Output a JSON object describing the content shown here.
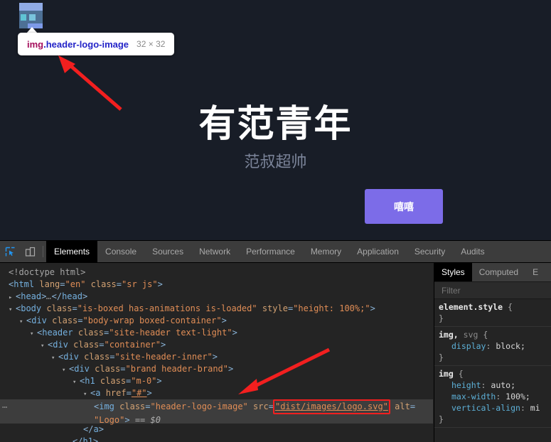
{
  "page": {
    "title": "有范青年",
    "subtitle": "范叔超帅",
    "button_label": "嘻嘻",
    "background_color": "#181d27",
    "button_color": "#7c6ce8"
  },
  "inspector_tooltip": {
    "tag": "img",
    "class": ".header-logo-image",
    "dimensions": "32 × 32"
  },
  "devtools": {
    "toolbar_icons": [
      "inspect-element-icon",
      "device-toolbar-icon"
    ],
    "tabs": [
      {
        "label": "Elements",
        "active": true
      },
      {
        "label": "Console",
        "active": false
      },
      {
        "label": "Sources",
        "active": false
      },
      {
        "label": "Network",
        "active": false
      },
      {
        "label": "Performance",
        "active": false
      },
      {
        "label": "Memory",
        "active": false
      },
      {
        "label": "Application",
        "active": false
      },
      {
        "label": "Security",
        "active": false
      },
      {
        "label": "Audits",
        "active": false
      }
    ],
    "dom_rows": [
      {
        "text": "<!doctype html>"
      },
      {
        "text": "<html lang=\"en\" class=\"sr js\">"
      },
      {
        "text": "<head>…</head>"
      },
      {
        "text": "<body class=\"is-boxed has-animations is-loaded\" style=\"height: 100%;\">"
      },
      {
        "text": "<div class=\"body-wrap boxed-container\">"
      },
      {
        "text": "<header class=\"site-header text-light\">"
      },
      {
        "text": "<div class=\"container\">"
      },
      {
        "text": "<div class=\"site-header-inner\">"
      },
      {
        "text": "<div class=\"brand header-brand\">"
      },
      {
        "text": "<h1 class=\"m-0\">"
      },
      {
        "text": "<a href=\"#\">"
      },
      {
        "text": "<img class=\"header-logo-image\" src=\"dist/images/logo.svg\" alt=\"Logo\"> == $0"
      },
      {
        "text": "</a>"
      },
      {
        "text": "</h1>"
      }
    ],
    "highlighted_src": "dist/images/logo.svg",
    "selected_marker": "== $0",
    "gutter_ellipsis": "…"
  },
  "styles": {
    "tabs": [
      {
        "label": "Styles",
        "active": true
      },
      {
        "label": "Computed",
        "active": false
      },
      {
        "label": "E",
        "active": false
      }
    ],
    "filter_placeholder": "Filter",
    "rules": [
      {
        "selector": "element.style",
        "selector_dim": "",
        "declarations": []
      },
      {
        "selector": "img,",
        "selector_dim": "svg",
        "declarations": [
          {
            "property": "display",
            "value": "block;"
          }
        ]
      },
      {
        "selector": "img",
        "selector_dim": "",
        "declarations": [
          {
            "property": "height",
            "value": "auto;"
          },
          {
            "property": "max-width",
            "value": "100%;"
          },
          {
            "property": "vertical-align",
            "value": "mi"
          }
        ]
      }
    ]
  },
  "annotations": {
    "arrow_color": "#f21f1f",
    "arrow_top_target": "logo-tooltip",
    "arrow_bottom_target": "image-src-attribute"
  }
}
